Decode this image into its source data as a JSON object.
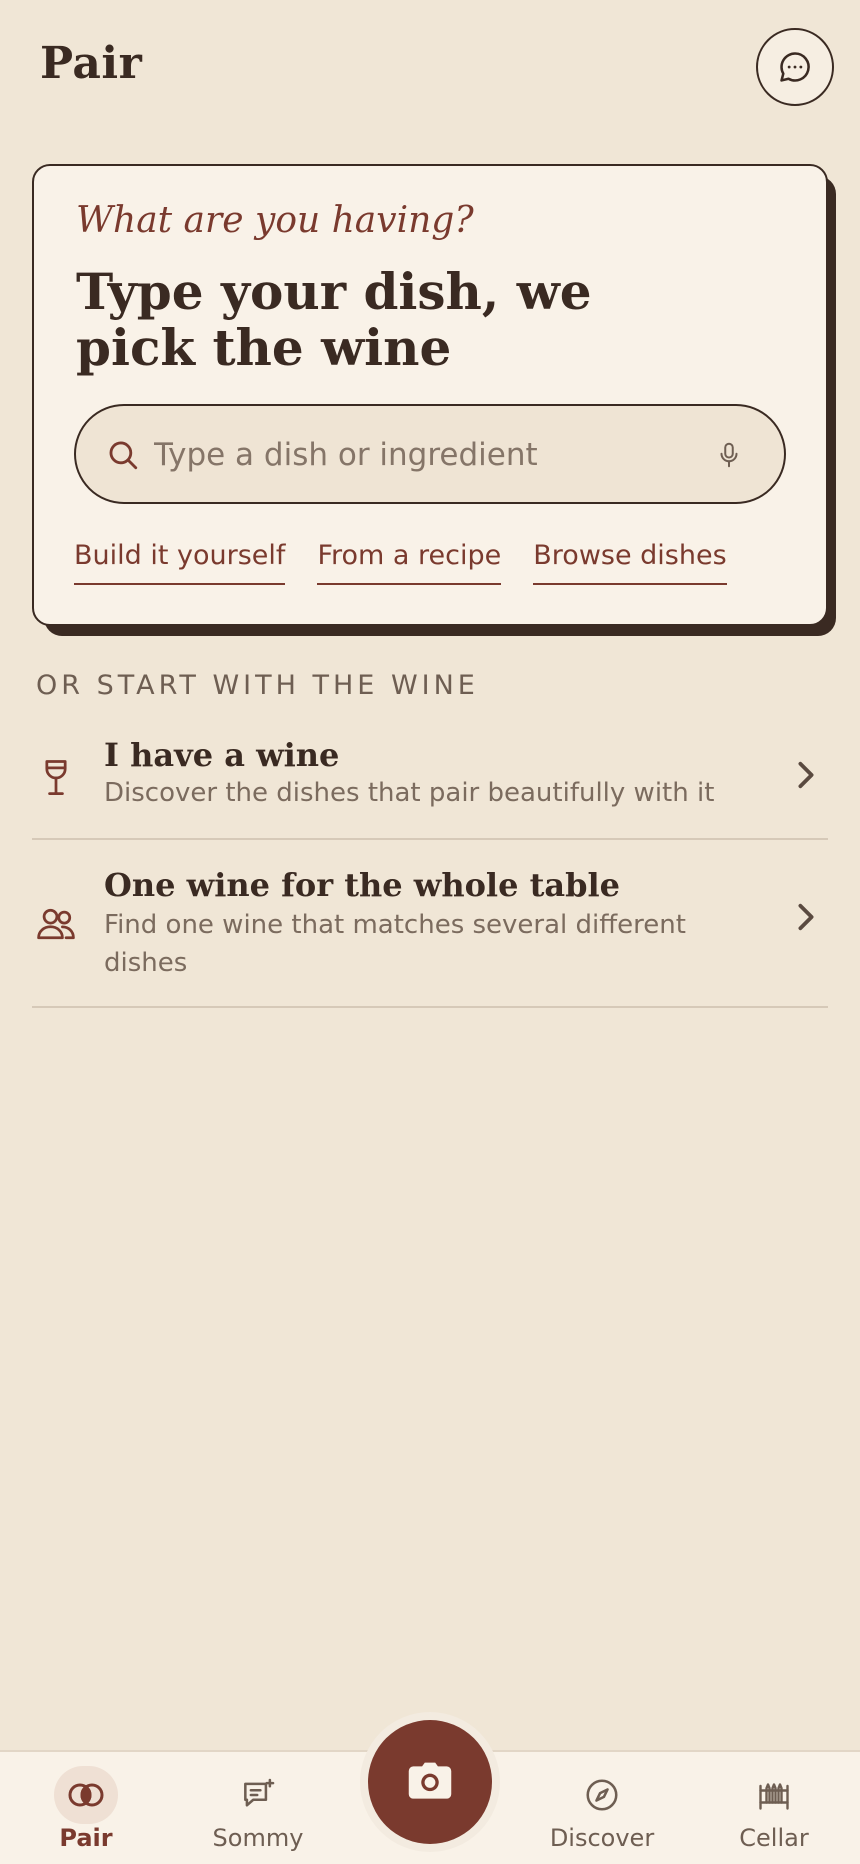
{
  "header": {
    "title": "Pair",
    "chat_icon": "chat-bubble-icon"
  },
  "hero": {
    "kicker": "What are you having?",
    "title": "Type your dish, we pick the wine",
    "search": {
      "placeholder": "Type a dish or ingredient",
      "value": ""
    },
    "links": [
      {
        "label": "Build it yourself"
      },
      {
        "label": "From a recipe"
      },
      {
        "label": "Browse dishes"
      }
    ]
  },
  "section": {
    "heading": "OR START WITH THE WINE",
    "options": [
      {
        "icon": "wine-glass-icon",
        "title": "I have a wine",
        "description": "Discover the dishes that pair beautifully with it"
      },
      {
        "icon": "people-icon",
        "title": "One wine for the whole table",
        "description": "Find one wine that matches several different dishes"
      }
    ]
  },
  "nav": {
    "items": [
      {
        "label": "Pair",
        "icon": "pair-rings-icon",
        "active": true
      },
      {
        "label": "Sommy",
        "icon": "sommy-chat-icon",
        "active": false
      },
      {
        "label": "Discover",
        "icon": "compass-icon",
        "active": false
      },
      {
        "label": "Cellar",
        "icon": "wine-rack-icon",
        "active": false
      }
    ],
    "center_icon": "camera-icon"
  },
  "colors": {
    "background": "#f0e6d6",
    "card": "#f9f2e8",
    "accent": "#7a3a2e",
    "text": "#3a2a22",
    "muted": "#7b6b5e"
  }
}
